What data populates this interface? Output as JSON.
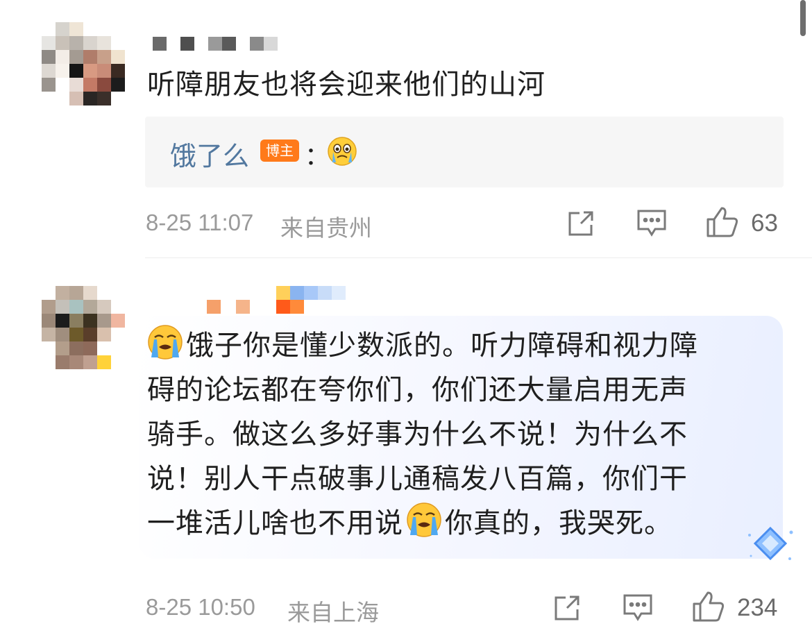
{
  "comments": [
    {
      "text": "听障朋友也将会迎来他们的山河",
      "reply": {
        "author": "饿了么",
        "badge": "博主",
        "separator": "：",
        "emoji": "crying-face"
      },
      "timestamp": "8-25 11:07",
      "location": "来自贵州",
      "likes": "63"
    },
    {
      "lines": [
        "饿子你是懂少数派的。听力障碍和视力障",
        "碍的论坛都在夸你们，你们还大量启用无声",
        "骑手。做这么多好事为什么不说！为什么不",
        "说！别人干点破事儿通稿发八百篇，你们干",
        "一堆活儿啥也不用说",
        "你真的，我哭死。"
      ],
      "emoji": "loudly-crying-face",
      "timestamp": "8-25 10:50",
      "location": "来自上海",
      "likes": "234"
    }
  ],
  "colors": {
    "link": "#52789f",
    "badge": "#ff7a1a",
    "meta": "#9a9a9a",
    "background": "#ffffff",
    "reply_bg": "#f6f6f6"
  },
  "icons": [
    "repost-icon",
    "comment-icon",
    "like-icon",
    "crying-face-emoji",
    "fan-badge-icon"
  ]
}
